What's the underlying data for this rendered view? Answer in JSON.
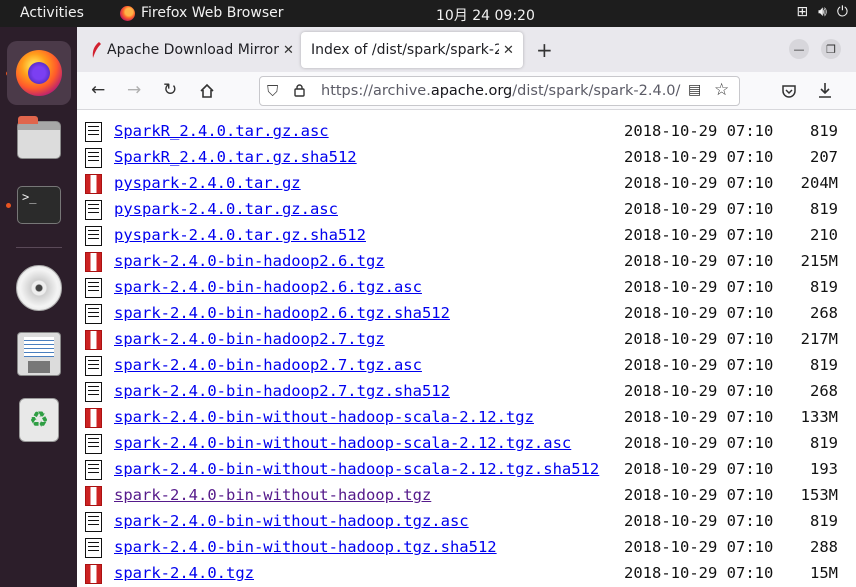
{
  "topbar": {
    "activities": "Activities",
    "app_name": "Firefox Web Browser",
    "clock": "10月 24  09:20"
  },
  "tabs": [
    {
      "label": "Apache Download Mirror",
      "active": false
    },
    {
      "label": "Index of /dist/spark/spark-2.",
      "active": true
    }
  ],
  "url": {
    "prefix": "https://archive.",
    "domain": "apache.org",
    "path": "/dist/spark/spark-2.4.0/"
  },
  "listing": [
    {
      "name": "SparkR_2.4.0.tar.gz.asc",
      "date": "2018-10-29 07:10",
      "size": "819",
      "type": "text",
      "visited": false
    },
    {
      "name": "SparkR_2.4.0.tar.gz.sha512",
      "date": "2018-10-29 07:10",
      "size": "207",
      "type": "text",
      "visited": false
    },
    {
      "name": "pyspark-2.4.0.tar.gz",
      "date": "2018-10-29 07:10",
      "size": "204M",
      "type": "binary",
      "visited": false
    },
    {
      "name": "pyspark-2.4.0.tar.gz.asc",
      "date": "2018-10-29 07:10",
      "size": "819",
      "type": "text",
      "visited": false
    },
    {
      "name": "pyspark-2.4.0.tar.gz.sha512",
      "date": "2018-10-29 07:10",
      "size": "210",
      "type": "text",
      "visited": false
    },
    {
      "name": "spark-2.4.0-bin-hadoop2.6.tgz",
      "date": "2018-10-29 07:10",
      "size": "215M",
      "type": "binary",
      "visited": false
    },
    {
      "name": "spark-2.4.0-bin-hadoop2.6.tgz.asc",
      "date": "2018-10-29 07:10",
      "size": "819",
      "type": "text",
      "visited": false
    },
    {
      "name": "spark-2.4.0-bin-hadoop2.6.tgz.sha512",
      "date": "2018-10-29 07:10",
      "size": "268",
      "type": "text",
      "visited": false
    },
    {
      "name": "spark-2.4.0-bin-hadoop2.7.tgz",
      "date": "2018-10-29 07:10",
      "size": "217M",
      "type": "binary",
      "visited": false
    },
    {
      "name": "spark-2.4.0-bin-hadoop2.7.tgz.asc",
      "date": "2018-10-29 07:10",
      "size": "819",
      "type": "text",
      "visited": false
    },
    {
      "name": "spark-2.4.0-bin-hadoop2.7.tgz.sha512",
      "date": "2018-10-29 07:10",
      "size": "268",
      "type": "text",
      "visited": false
    },
    {
      "name": "spark-2.4.0-bin-without-hadoop-scala-2.12.tgz",
      "date": "2018-10-29 07:10",
      "size": "133M",
      "type": "binary",
      "visited": false
    },
    {
      "name": "spark-2.4.0-bin-without-hadoop-scala-2.12.tgz.asc",
      "date": "2018-10-29 07:10",
      "size": "819",
      "type": "text",
      "visited": false
    },
    {
      "name": "spark-2.4.0-bin-without-hadoop-scala-2.12.tgz.sha512",
      "date": "2018-10-29 07:10",
      "size": "193",
      "type": "text",
      "visited": false
    },
    {
      "name": "spark-2.4.0-bin-without-hadoop.tgz",
      "date": "2018-10-29 07:10",
      "size": "153M",
      "type": "binary",
      "visited": true
    },
    {
      "name": "spark-2.4.0-bin-without-hadoop.tgz.asc",
      "date": "2018-10-29 07:10",
      "size": "819",
      "type": "text",
      "visited": false
    },
    {
      "name": "spark-2.4.0-bin-without-hadoop.tgz.sha512",
      "date": "2018-10-29 07:10",
      "size": "288",
      "type": "text",
      "visited": false
    },
    {
      "name": "spark-2.4.0.tgz",
      "date": "2018-10-29 07:10",
      "size": "15M",
      "type": "binary",
      "visited": false
    }
  ]
}
